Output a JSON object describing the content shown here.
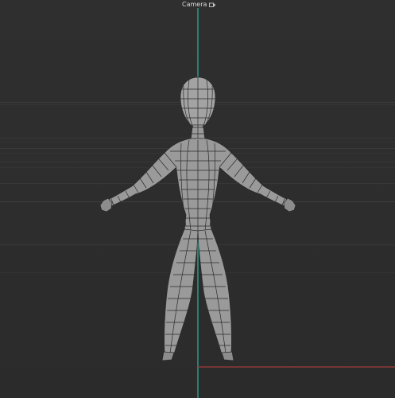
{
  "viewport": {
    "camera_label": "Camera",
    "camera_icon": "camera-lock-icon",
    "colors": {
      "background": "#2e2e2e",
      "y_axis": "#2bb3a0",
      "x_axis": "#8b3a3a",
      "mesh_fill": "#9a9a9a",
      "mesh_wire": "#2a2a2a"
    }
  }
}
